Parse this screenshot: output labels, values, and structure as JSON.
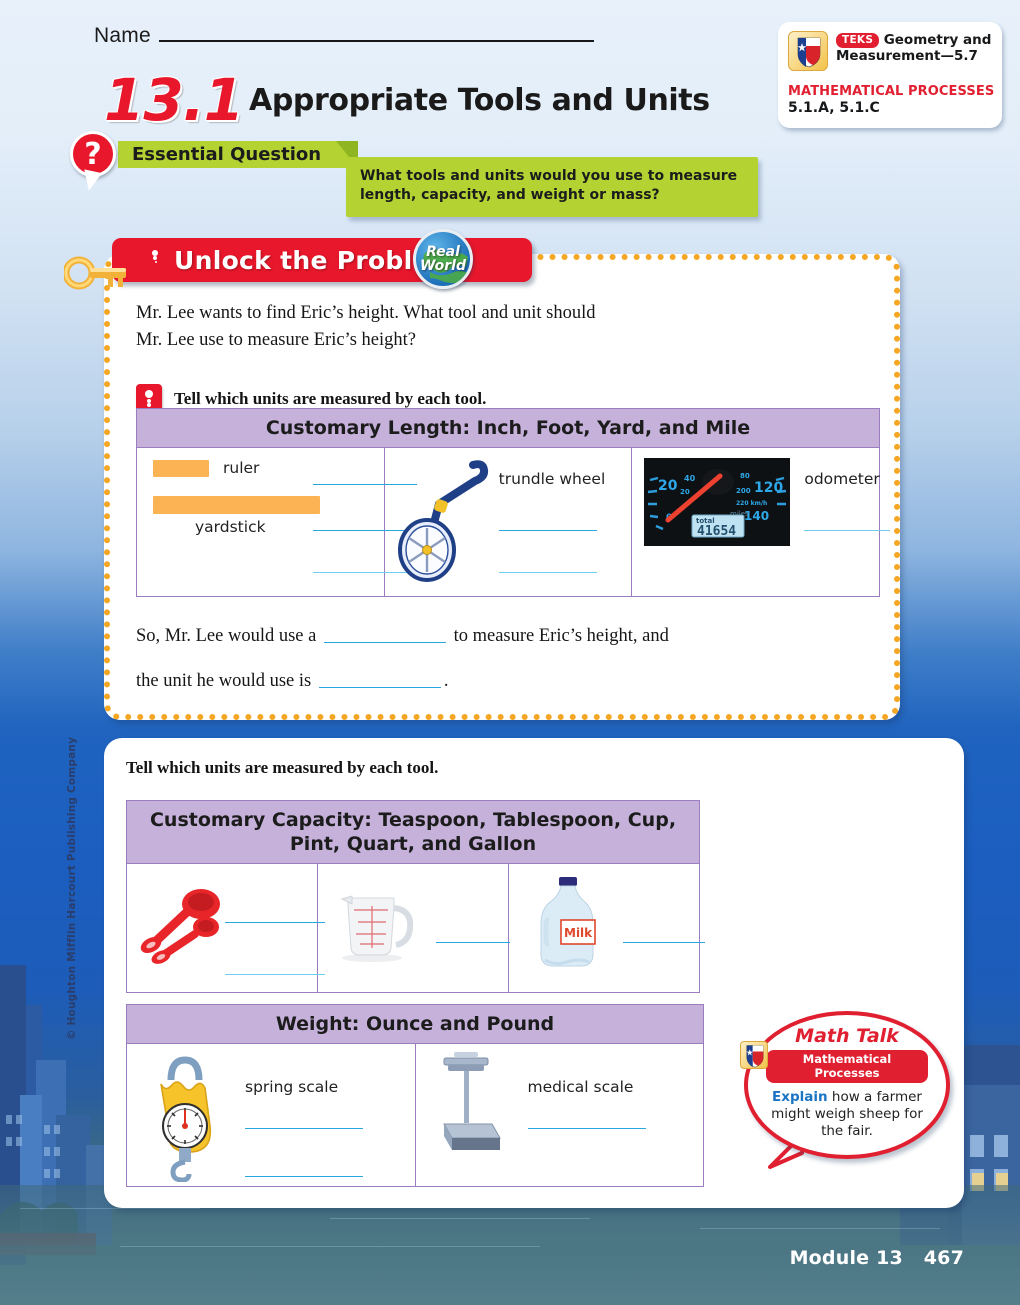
{
  "page": {
    "name_label": "Name",
    "lesson_number": "13.1",
    "lesson_title": "Appropriate Tools and Units",
    "footer_module": "Module 13",
    "footer_page": "467",
    "copyright": "© Houghton Mifflin Harcourt Publishing Company",
    "colors": {
      "red": "#e8172b",
      "green": "#b4d333",
      "purple_header": "#c5b1da",
      "purple_border": "#9a7cbf",
      "blue_rule": "#29a8e0",
      "orange_dots": "#f5a623",
      "link_blue": "#1a74c4"
    }
  },
  "teks": {
    "pill": "TEKS",
    "standard_line1": "Geometry and",
    "standard_line2": "Measurement—5.7",
    "processes_label": "MATHEMATICAL PROCESSES",
    "processes_codes": "5.1.A, 5.1.C",
    "badge_icon": "texas-flag-icon"
  },
  "essential_question": {
    "icon": "question-mark-icon",
    "band_label": "Essential Question",
    "body_line1": "What tools and units would you use to measure",
    "body_line2": "length, capacity, and weight or mass?"
  },
  "unlock": {
    "banner_label": "Unlock the Problem",
    "banner_icon": "key-icon",
    "lock_icon": "lock-icon",
    "real_world_line1": "Real",
    "real_world_line2": "World",
    "problem_line1": "Mr. Lee wants to find Eric’s height. What tool and unit should",
    "problem_line2": "Mr. Lee use to measure Eric’s height?",
    "tell_instruction": "Tell which units are measured by each tool.",
    "conclusion_a_before": "So, Mr. Lee would use a",
    "conclusion_a_after": "to measure Eric’s height, and",
    "conclusion_b_before": "the unit he would use is",
    "conclusion_b_after": "."
  },
  "length_table": {
    "title": "Customary Length: Inch, Foot, Yard, and Mile",
    "cells": [
      {
        "tools": [
          "ruler",
          "yardstick"
        ],
        "icons": [
          "ruler-icon",
          "yardstick-icon"
        ],
        "blanks": 3
      },
      {
        "tools": [
          "trundle wheel"
        ],
        "icons": [
          "trundle-wheel-icon"
        ],
        "blanks": 2
      },
      {
        "tools": [
          "odometer"
        ],
        "icons": [
          "odometer-icon"
        ],
        "odometer_reading": "41654",
        "odometer_total_label": "total",
        "odometer_ticks": [
          "20",
          "40",
          "20",
          "80",
          "120",
          "200",
          "220 km/h",
          "140",
          "miles",
          "0"
        ],
        "blanks": 1
      }
    ]
  },
  "lower": {
    "tell_instruction": "Tell which units are measured by each tool."
  },
  "capacity_table": {
    "title_line1": "Customary Capacity: Teaspoon, Tablespoon, Cup,",
    "title_line2": "Pint, Quart, and Gallon",
    "cells": [
      {
        "icon": "measuring-spoons-icon",
        "blanks": 2
      },
      {
        "icon": "measuring-cup-icon",
        "blanks": 1
      },
      {
        "icon": "milk-gallon-icon",
        "label": "Milk",
        "blanks": 1
      }
    ]
  },
  "weight_table": {
    "title": "Weight: Ounce and Pound",
    "cells": [
      {
        "icon": "spring-scale-icon",
        "label": "spring scale",
        "blanks": 2
      },
      {
        "icon": "medical-scale-icon",
        "label": "medical scale",
        "blanks": 1
      }
    ]
  },
  "math_talk": {
    "title": "Math Talk",
    "pill": "Mathematical Processes",
    "badge_icon": "texas-flag-icon",
    "prompt_keyword": "Explain",
    "prompt_rest": " how a farmer might weigh sheep for the fair."
  }
}
